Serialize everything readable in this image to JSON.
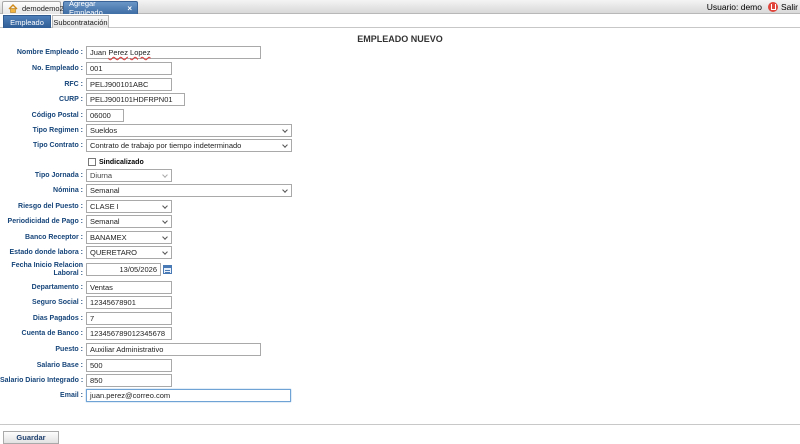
{
  "tabs": {
    "home_label": "demodemo2",
    "active_label": "Agregar Empleado",
    "close_glyph": "×"
  },
  "user": {
    "label": "Usuario: demo",
    "exit_label": "Salir"
  },
  "subtabs": {
    "employee": "Empleado",
    "outsourcing": "Subcontratación"
  },
  "form": {
    "title": "EMPLEADO NUEVO",
    "nombre": {
      "label": "Nombre Empleado :",
      "value_first": "Juan ",
      "value_mid": "Perez",
      "value_gap": " ",
      "value_last": "Lopez"
    },
    "no_empleado": {
      "label": "No. Empleado :",
      "value": "001"
    },
    "rfc": {
      "label": "RFC :",
      "value": "PELJ900101ABC"
    },
    "curp": {
      "label": "CURP :",
      "value": "PELJ900101HDFRPN01"
    },
    "codigo_postal": {
      "label": "Código Postal :",
      "value": "06000"
    },
    "tipo_regimen": {
      "label": "Tipo Regimen :",
      "value": "Sueldos"
    },
    "tipo_contrato": {
      "label": "Tipo Contrato :",
      "value": "Contrato de trabajo por tiempo indeterminado"
    },
    "sindicalizado": {
      "label": "Sindicalizado",
      "checked": false
    },
    "tipo_jornada": {
      "label": "Tipo Jornada :",
      "value": "Diurna"
    },
    "nomina": {
      "label": "Nómina :",
      "value": "Semanal"
    },
    "riesgo": {
      "label": "Riesgo del Puesto :",
      "value": "CLASE I"
    },
    "periodicidad": {
      "label": "Periodicidad de Pago :",
      "value": "Semanal"
    },
    "banco": {
      "label": "Banco Receptor :",
      "value": "BANAMEX"
    },
    "estado": {
      "label": "Estado donde labora :",
      "value": "QUERETARO"
    },
    "fecha_inicio": {
      "label_line1": "Fecha Inicio Relacion",
      "label_line2": "Laboral :",
      "value": "13/05/2026"
    },
    "departamento": {
      "label": "Departamento :",
      "value": "Ventas"
    },
    "seguro_social": {
      "label": "Seguro Social :",
      "value": "12345678901"
    },
    "dias_pagados": {
      "label": "Dias Pagados :",
      "value": "7"
    },
    "cuenta_banco": {
      "label": "Cuenta de Banco :",
      "value": "123456789012345678"
    },
    "puesto": {
      "label": "Puesto :",
      "value": "Auxiliar Administrativo"
    },
    "salario_base": {
      "label": "Salario Base :",
      "value": "500"
    },
    "salario_diario": {
      "label": "Salario Diario Integrado :",
      "value": "850"
    },
    "email": {
      "label": "Email :",
      "value": "juan.perez@correo.com"
    }
  },
  "actions": {
    "save": "Guardar"
  },
  "colors": {
    "label": "#16457a",
    "tab_active": "#3f6ea5",
    "exit": "#e0443a"
  },
  "icons": {
    "home": "home-icon",
    "exit": "exit-icon",
    "calendar": "calendar-icon",
    "chevron": "chevron-down-icon"
  }
}
